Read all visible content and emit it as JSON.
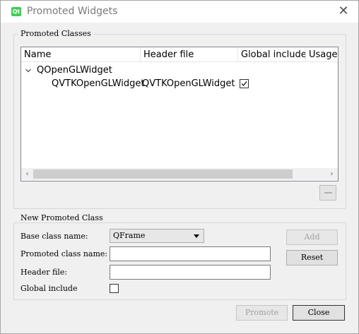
{
  "window": {
    "title": "Promoted Widgets",
    "app_icon_text": "Qt"
  },
  "promoted_classes": {
    "group_title": "Promoted Classes",
    "columns": [
      "Name",
      "Header file",
      "Global include",
      "Usage"
    ],
    "base_item": "QOpenGLWidget",
    "child": {
      "name": "QVTKOpenGLWidget",
      "header": "QVTKOpenGLWidget.h",
      "global_include_checked": true
    }
  },
  "new_class": {
    "group_title": "New Promoted Class",
    "base_class_label": "Base class name:",
    "base_class_value": "QFrame",
    "promoted_name_label": "Promoted class name:",
    "promoted_name_value": "",
    "header_file_label": "Header file:",
    "header_file_value": "",
    "global_include_label": "Global include",
    "global_include_checked": false,
    "add_label": "Add",
    "reset_label": "Reset"
  },
  "footer": {
    "promote_label": "Promote",
    "close_label": "Close"
  }
}
